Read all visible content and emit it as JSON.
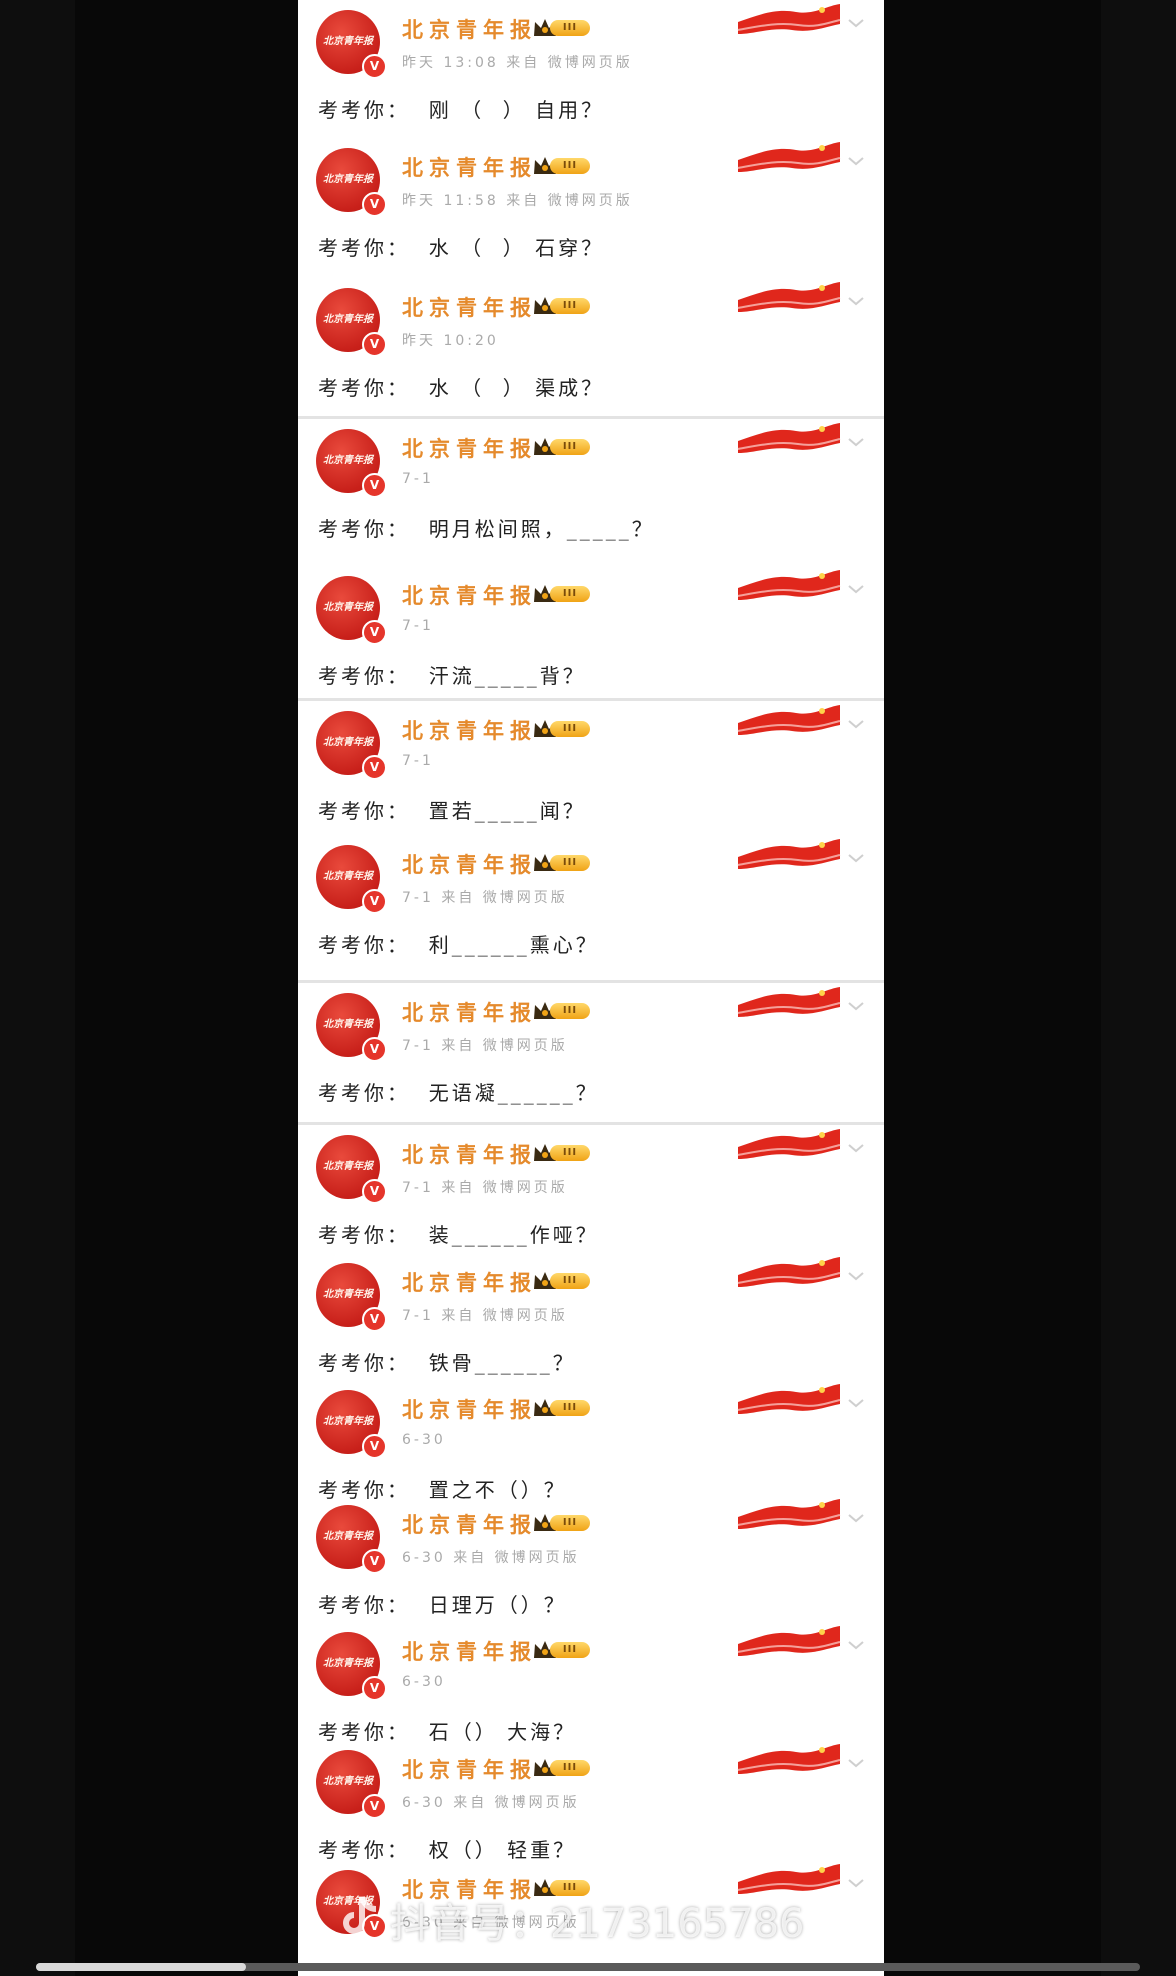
{
  "account": {
    "name": "北京青年报",
    "avatar_text": "北京青年报",
    "verified_badge": "V",
    "vip_level": "III"
  },
  "posts": [
    {
      "meta": "昨天 13:08  来自  微博网页版",
      "question": "考考你：  刚 （  ） 自用？"
    },
    {
      "meta": "昨天 11:58  来自  微博网页版",
      "question": "考考你：  水 （  ） 石穿？"
    },
    {
      "meta": "昨天 10:20",
      "question": "考考你：  水 （  ） 渠成？"
    },
    {
      "meta": "7-1",
      "question": "考考你：  明月松间照，_____？"
    },
    {
      "meta": "7-1",
      "question": "考考你：  汗流_____背？"
    },
    {
      "meta": "7-1",
      "question": "考考你：  置若_____闻？"
    },
    {
      "meta": "7-1  来自  微博网页版",
      "question": "考考你：  利______熏心？"
    },
    {
      "meta": "7-1  来自  微博网页版",
      "question": "考考你：  无语凝______？"
    },
    {
      "meta": "7-1  来自  微博网页版",
      "question": "考考你：  装______作哑？"
    },
    {
      "meta": "7-1  来自  微博网页版",
      "question": "考考你：  铁骨______？"
    },
    {
      "meta": "6-30",
      "question": "考考你：  置之不（）？"
    },
    {
      "meta": "6-30  来自  微博网页版",
      "question": "考考你：  日理万（）？"
    },
    {
      "meta": "6-30",
      "question": "考考你：  石（） 大海？"
    },
    {
      "meta": "6-30  来自  微博网页版",
      "question": "考考你：  权（） 轻重？"
    },
    {
      "meta": "6-30  来自  微博网页版",
      "question": ""
    }
  ],
  "icons": {
    "avatar": "newspaper-logo-icon",
    "verified": "verified-v-icon",
    "vip": "crown-icon",
    "banner": "red-flag-banner-icon",
    "menu": "chevron-down-icon",
    "watermark": "douyin-icon"
  },
  "watermark": {
    "text": "抖音号：2173165786"
  },
  "player": {
    "progress": 0.19
  },
  "colors": {
    "brand_red": "#d8261d",
    "name_orange": "#e58a2c",
    "vip_gold": "#f0a316"
  }
}
